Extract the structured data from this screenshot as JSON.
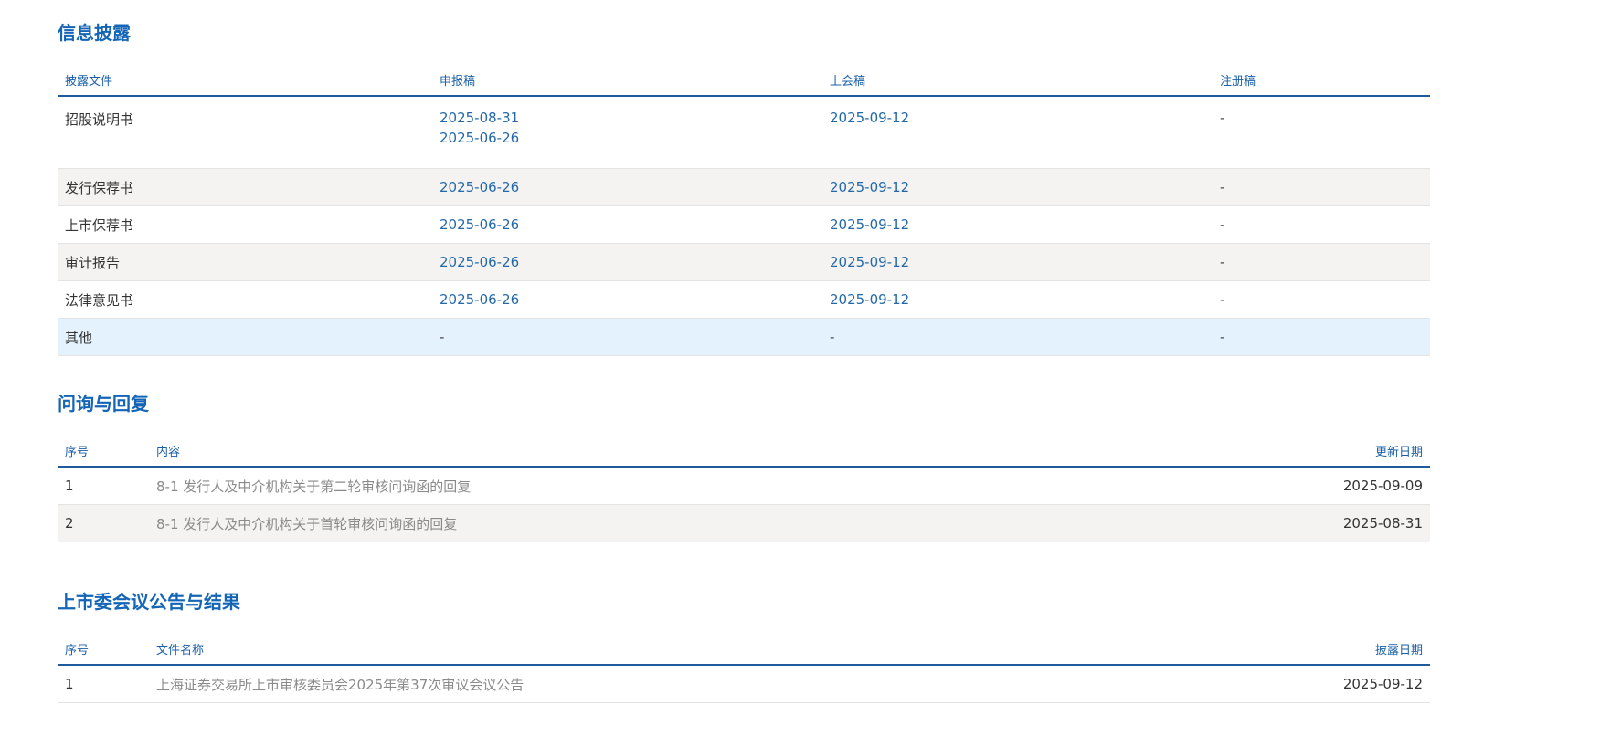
{
  "disclosure": {
    "title": "信息披露",
    "headers": [
      "披露文件",
      "申报稿",
      "上会稿",
      "注册稿"
    ],
    "rows": [
      {
        "name": "招股说明书",
        "filing": [
          "2025-08-31",
          "2025-06-26"
        ],
        "meeting": "2025-09-12",
        "registration": "-"
      },
      {
        "name": "发行保荐书",
        "filing": [
          "2025-06-26"
        ],
        "meeting": "2025-09-12",
        "registration": "-"
      },
      {
        "name": "上市保荐书",
        "filing": [
          "2025-06-26"
        ],
        "meeting": "2025-09-12",
        "registration": "-"
      },
      {
        "name": "审计报告",
        "filing": [
          "2025-06-26"
        ],
        "meeting": "2025-09-12",
        "registration": "-"
      },
      {
        "name": "法律意见书",
        "filing": [
          "2025-06-26"
        ],
        "meeting": "2025-09-12",
        "registration": "-"
      },
      {
        "name": "其他",
        "filing": [
          "-"
        ],
        "meeting": "-",
        "registration": "-"
      }
    ]
  },
  "inquiry": {
    "title": "问询与回复",
    "headers": [
      "序号",
      "内容",
      "更新日期"
    ],
    "rows": [
      {
        "seq": "1",
        "content": "8-1 发行人及中介机构关于第二轮审核问询函的回复",
        "date": "2025-09-09"
      },
      {
        "seq": "2",
        "content": "8-1 发行人及中介机构关于首轮审核问询函的回复",
        "date": "2025-08-31"
      }
    ]
  },
  "committee": {
    "title": "上市委会议公告与结果",
    "headers": [
      "序号",
      "文件名称",
      "披露日期"
    ],
    "rows": [
      {
        "seq": "1",
        "content": "上海证券交易所上市审核委员会2025年第37次审议会议公告",
        "date": "2025-09-12"
      }
    ]
  },
  "colors": {
    "title": "#1565b6",
    "header_text": "#1a5fa8",
    "header_rule": "#1f5a9c",
    "link": "#2468a8",
    "row_alt": "#f4f3f2",
    "row_highlight": "#e3f2fc"
  }
}
